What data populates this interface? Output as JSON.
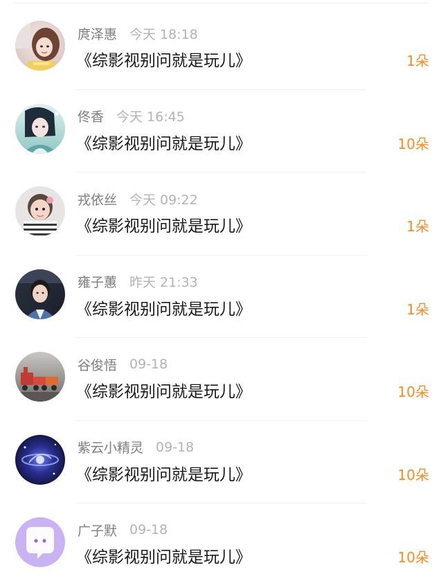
{
  "comments": [
    {
      "user": "庹泽惠",
      "time": "今天 18:18",
      "text": "《综影视别问就是玩儿》",
      "gift": "1朵",
      "avatar": "girl-photo-avatar"
    },
    {
      "user": "佟香",
      "time": "今天 16:45",
      "text": "《综影视别问就是玩儿》",
      "gift": "10朵",
      "avatar": "anime-character-avatar"
    },
    {
      "user": "戎依丝",
      "time": "今天 09:22",
      "text": "《综影视别问就是玩儿》",
      "gift": "1朵",
      "avatar": "baby-photo-avatar"
    },
    {
      "user": "雍子蕙",
      "time": "昨天 21:33",
      "text": "《综影视别问就是玩儿》",
      "gift": "1朵",
      "avatar": "young-man-photo-avatar"
    },
    {
      "user": "谷俊悟",
      "time": "09-18",
      "text": "《综影视别问就是玩儿》",
      "gift": "10朵",
      "avatar": "toy-train-avatar"
    },
    {
      "user": "紫云小精灵",
      "time": "09-18",
      "text": "《综影视别问就是玩儿》",
      "gift": "10朵",
      "avatar": "galaxy-avatar"
    },
    {
      "user": "广子默",
      "time": "09-18",
      "text": "《综影视别问就是玩儿》",
      "gift": "10朵",
      "avatar": "default-chat-avatar"
    }
  ],
  "colors": {
    "gift": "#ff8a1f",
    "username": "#7d7d7d",
    "time": "#b3b3b3",
    "title": "#1a1a1a",
    "default_avatar": "#c9b3f5"
  }
}
